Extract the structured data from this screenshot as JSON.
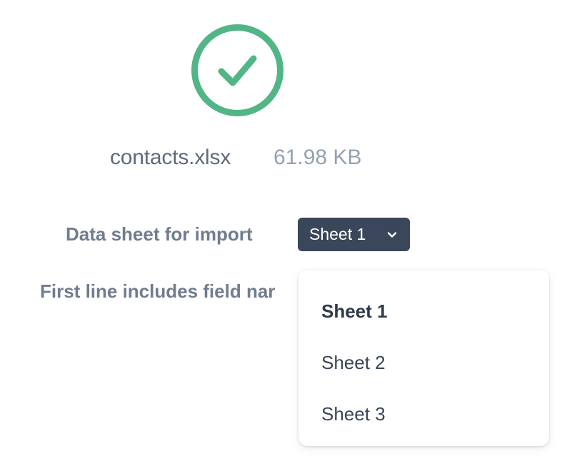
{
  "upload": {
    "status_icon": "check-circle-icon",
    "status_color": "#52b585",
    "file_name": "contacts.xlsx",
    "file_size": "61.98 KB"
  },
  "sheet_selector": {
    "label": "Data sheet for import",
    "selected": "Sheet 1",
    "chevron_icon": "chevron-down-icon",
    "background_color": "#3a475a",
    "options": [
      {
        "label": "Sheet 1",
        "selected": true
      },
      {
        "label": "Sheet 2",
        "selected": false
      },
      {
        "label": "Sheet 3",
        "selected": false
      }
    ]
  },
  "first_line": {
    "label": "First line includes field nar"
  }
}
